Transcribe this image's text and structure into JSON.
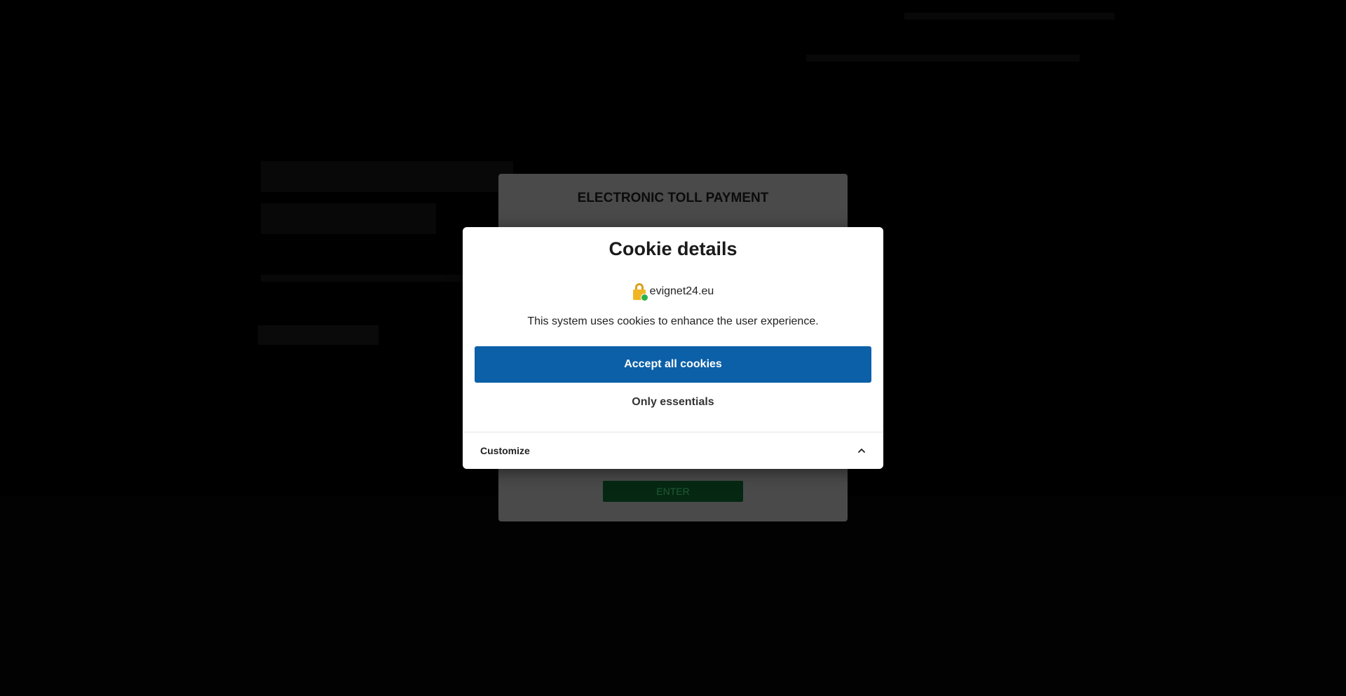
{
  "toll_panel": {
    "title": "ELECTRONIC TOLL PAYMENT",
    "enter_label": "ENTER"
  },
  "cookie_modal": {
    "title": "Cookie details",
    "site": "evignet24.eu",
    "description": "This system uses cookies to enhance the user experience.",
    "accept_label": "Accept all cookies",
    "essentials_label": "Only essentials",
    "customize_label": "Customize"
  },
  "colors": {
    "accept_button": "#0c60a8",
    "overlay": "#000000",
    "enter_button": "#062812"
  },
  "icons": {
    "site": "lock-icon",
    "customize": "chevron-up-icon"
  }
}
